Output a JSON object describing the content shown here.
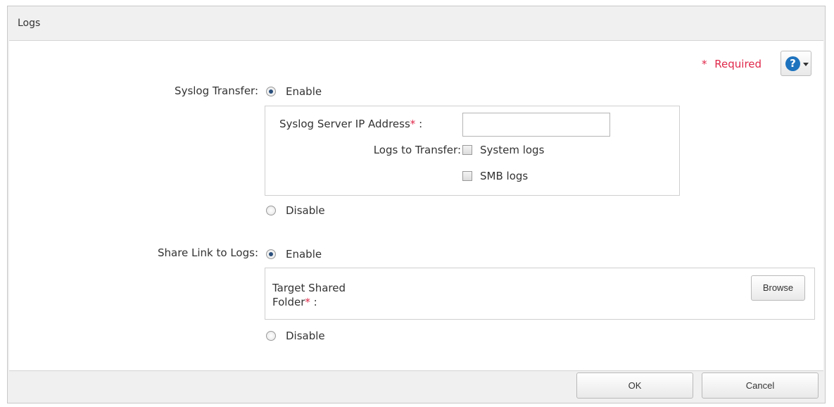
{
  "dialog": {
    "title": "Logs"
  },
  "required": {
    "marker": "*",
    "label": "Required"
  },
  "help": {
    "icon": "?"
  },
  "syslog": {
    "label": "Syslog Transfer:",
    "enable_label": "Enable",
    "disable_label": "Disable",
    "selected": "enable",
    "server_ip_label": "Syslog Server IP Address",
    "server_ip_suffix": ":",
    "server_ip_value": "",
    "server_ip_placeholder": "",
    "logs_to_transfer_label": "Logs to Transfer:",
    "log_options": [
      {
        "label": "System logs",
        "checked": false
      },
      {
        "label": "SMB logs",
        "checked": false
      }
    ]
  },
  "share_link": {
    "label": "Share Link to Logs:",
    "enable_label": "Enable",
    "disable_label": "Disable",
    "selected": "enable",
    "target_line1": "Target Shared",
    "target_line2": "Folder",
    "target_suffix": ":",
    "browse_label": "Browse"
  },
  "footer": {
    "ok_label": "OK",
    "cancel_label": "Cancel"
  },
  "star": "*",
  "colors": {
    "required": "#e0284a",
    "help_icon": "#1e73be"
  }
}
